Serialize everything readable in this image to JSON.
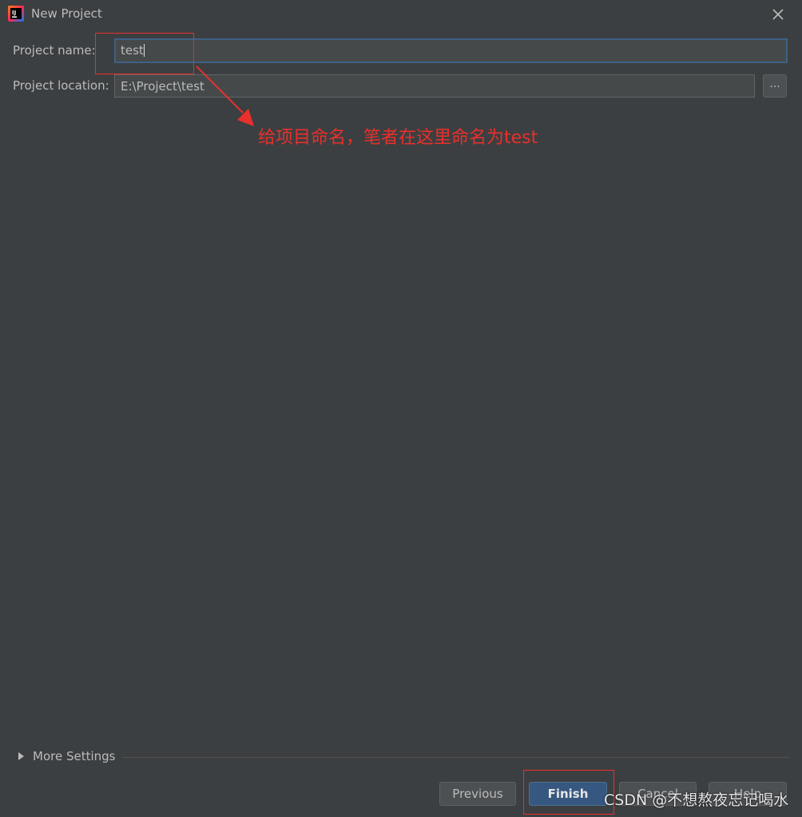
{
  "window": {
    "title": "New Project",
    "app_icon": "intellij-idea-icon",
    "close_icon": "close-icon"
  },
  "form": {
    "project_name_label": "Project name:",
    "project_name_value": "test",
    "project_location_label": "Project location:",
    "project_location_value": "E:\\Project\\test",
    "browse_label": "..."
  },
  "annotation": {
    "text": "给项目命名，笔者在这里命名为test",
    "color": "#e8302c"
  },
  "more_settings": {
    "label": "More Settings",
    "icon": "triangle-right-icon"
  },
  "buttons": {
    "previous": "Previous",
    "finish": "Finish",
    "cancel": "Cancel",
    "help": "Help"
  },
  "watermark": "CSDN @不想熬夜忘记喝水",
  "colors": {
    "background": "#3c3f41",
    "field_background": "#45494a",
    "focus_border": "#3d6185",
    "primary_button": "#365880",
    "annotation_red": "#e8302c"
  }
}
